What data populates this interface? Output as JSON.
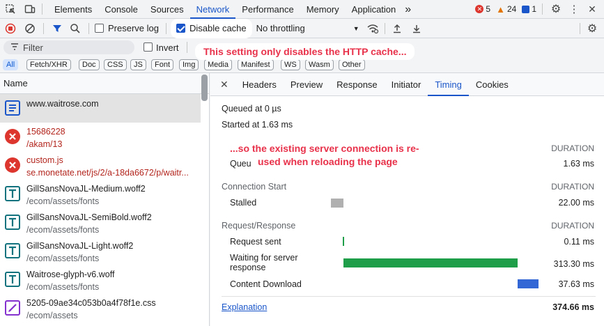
{
  "tabs": [
    {
      "label": "Elements"
    },
    {
      "label": "Console"
    },
    {
      "label": "Sources"
    },
    {
      "label": "Network"
    },
    {
      "label": "Performance"
    },
    {
      "label": "Memory"
    },
    {
      "label": "Application"
    }
  ],
  "more_tabs": "»",
  "counts": {
    "errors": "5",
    "warnings": "24",
    "info": "1"
  },
  "toolbar": {
    "preserve_log": "Preserve log",
    "disable_cache": "Disable cache",
    "throttling": "No throttling"
  },
  "filter": {
    "placeholder": "Filter",
    "invert": "Invert"
  },
  "types": [
    "All",
    "Fetch/XHR",
    "Doc",
    "CSS",
    "JS",
    "Font",
    "Img",
    "Media",
    "Manifest",
    "WS",
    "Wasm",
    "Other"
  ],
  "list_header": "Name",
  "requests": [
    {
      "name": "www.waitrose.com",
      "sub": "",
      "kind": "doc"
    },
    {
      "name": "15686228",
      "sub": "/akam/13",
      "kind": "error"
    },
    {
      "name": "custom.js",
      "sub": "se.monetate.net/js/2/a-18da6672/p/waitr...",
      "kind": "error"
    },
    {
      "name": "GillSansNovaJL-Medium.woff2",
      "sub": "/ecom/assets/fonts",
      "kind": "font"
    },
    {
      "name": "GillSansNovaJL-SemiBold.woff2",
      "sub": "/ecom/assets/fonts",
      "kind": "font"
    },
    {
      "name": "GillSansNovaJL-Light.woff2",
      "sub": "/ecom/assets/fonts",
      "kind": "font"
    },
    {
      "name": "Waitrose-glyph-v6.woff",
      "sub": "/ecom/assets/fonts",
      "kind": "font"
    },
    {
      "name": "5205-09ae34c053b0a4f78f1e.css",
      "sub": "/ecom/assets",
      "kind": "css"
    }
  ],
  "detail_tabs": [
    "Headers",
    "Preview",
    "Response",
    "Initiator",
    "Timing",
    "Cookies"
  ],
  "timing": {
    "queued_at": "Queued at 0 µs",
    "started_at": "Started at 1.63 ms",
    "resource_scheduling_partial": "Queu",
    "queueing_value": "1.63 ms",
    "duration_label": "DURATION",
    "connection_start": "Connection Start",
    "stalled_label": "Stalled",
    "stalled_value": "22.00 ms",
    "request_response": "Request/Response",
    "request_sent": "Request sent",
    "request_sent_value": "0.11 ms",
    "waiting_label": "Waiting for server response",
    "waiting_value": "313.30 ms",
    "download_label": "Content Download",
    "download_value": "37.63 ms",
    "explanation": "Explanation",
    "total": "374.66 ms"
  },
  "callouts": {
    "top": "This setting only disables the HTTP cache...",
    "middle_line1": "...so the existing server connection is re-",
    "middle_line2": "used when reloading the page"
  },
  "colors": {
    "accent": "#1a56c9",
    "callout_text": "#e8314a",
    "waiting_bar": "#1e9e48",
    "download_bar": "#3367d6",
    "stalled_bar": "#b0b0b0"
  }
}
